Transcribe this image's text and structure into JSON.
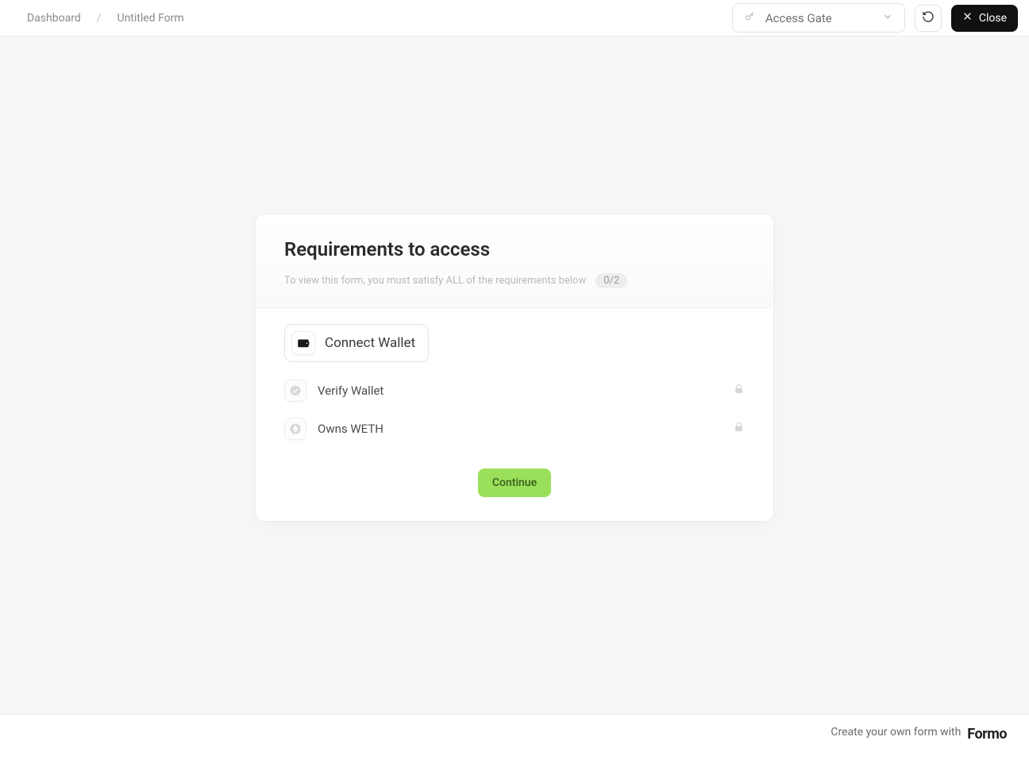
{
  "header": {
    "breadcrumb": {
      "dashboard": "Dashboard",
      "current": "Untitled Form"
    },
    "select_label": "Access Gate",
    "close_label": "Close"
  },
  "card": {
    "title": "Requirements to access",
    "subtitle": "To view this form, you must satisfy ALL of the requirements below",
    "progress": "0/2",
    "connect_label": "Connect Wallet",
    "requirements": [
      {
        "label": "Verify Wallet"
      },
      {
        "label": "Owns WETH"
      }
    ],
    "continue_label": "Continue"
  },
  "footer": {
    "text": "Create your own form with",
    "brand": "Formo"
  }
}
